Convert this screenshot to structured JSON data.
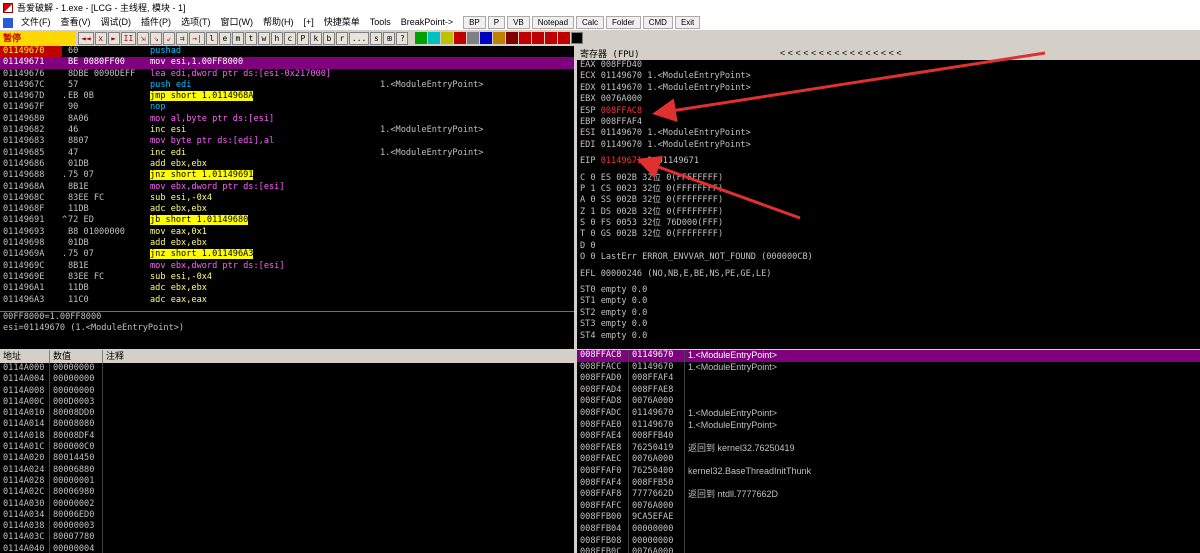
{
  "window": {
    "title": "吾爱破解 - 1.exe - [LCG - 主线程, 模块 - 1]"
  },
  "menu": {
    "items": [
      "文件(F)",
      "查看(V)",
      "调试(D)",
      "插件(P)",
      "选项(T)",
      "窗口(W)",
      "帮助(H)",
      "[+]",
      "快捷菜单",
      "Tools",
      "BreakPoint->"
    ],
    "buttons": [
      "BP",
      "P",
      "VB",
      "Notepad",
      "Calc",
      "Folder",
      "CMD",
      "Exit"
    ]
  },
  "toolbar": {
    "status": "暂停",
    "buttons": [
      "◄◄",
      "x",
      "►",
      "II",
      "⇲",
      "⇘",
      "⇙",
      "⇉",
      "→|",
      "l",
      "e",
      "m",
      "t",
      "w",
      "h",
      "c",
      "P",
      "k",
      "b",
      "r",
      "...",
      "s",
      "⊞",
      "?"
    ]
  },
  "disasm": {
    "rows": [
      {
        "addr": "01149670",
        "mark": "",
        "hex": "60",
        "code": "pushad",
        "note": "",
        "sel": false,
        "bp": true
      },
      {
        "addr": "01149671",
        "mark": "",
        "hex": "BE 0080FF00",
        "code": "mov esi,1.00FF8000",
        "note": "",
        "sel": true,
        "bp": false
      },
      {
        "addr": "01149676",
        "mark": "",
        "hex": "8DBE 0090DEFF",
        "code": "lea edi,dword ptr ds:[esi-0x217000]",
        "note": "",
        "sel": false,
        "bp": false
      },
      {
        "addr": "0114967C",
        "mark": "",
        "hex": "57",
        "code": "push edi",
        "note": "1.<ModuleEntryPoint>",
        "sel": false,
        "bp": false
      },
      {
        "addr": "0114967D",
        "mark": ".",
        "hex": "EB 0B",
        "code": "jmp short 1.0114968A",
        "note": "",
        "sel": false,
        "bp": false
      },
      {
        "addr": "0114967F",
        "mark": "",
        "hex": "90",
        "code": "nop",
        "note": "",
        "sel": false,
        "bp": false
      },
      {
        "addr": "01149680",
        "mark": "",
        "hex": "8A06",
        "code": "mov al,byte ptr ds:[esi]",
        "note": "",
        "sel": false,
        "bp": false
      },
      {
        "addr": "01149682",
        "mark": "",
        "hex": "46",
        "code": "inc esi",
        "note": "1.<ModuleEntryPoint>",
        "sel": false,
        "bp": false
      },
      {
        "addr": "01149683",
        "mark": "",
        "hex": "8807",
        "code": "mov byte ptr ds:[edi],al",
        "note": "",
        "sel": false,
        "bp": false
      },
      {
        "addr": "01149685",
        "mark": "",
        "hex": "47",
        "code": "inc edi",
        "note": "1.<ModuleEntryPoint>",
        "sel": false,
        "bp": false
      },
      {
        "addr": "01149686",
        "mark": "",
        "hex": "01DB",
        "code": "add ebx,ebx",
        "note": "",
        "sel": false,
        "bp": false
      },
      {
        "addr": "01149688",
        "mark": ".",
        "hex": "75 07",
        "code": "jnz short 1.01149691",
        "note": "",
        "sel": false,
        "bp": false
      },
      {
        "addr": "0114968A",
        "mark": "",
        "hex": "8B1E",
        "code": "mov ebx,dword ptr ds:[esi]",
        "note": "",
        "sel": false,
        "bp": false
      },
      {
        "addr": "0114968C",
        "mark": "",
        "hex": "83EE FC",
        "code": "sub esi,-0x4",
        "note": "",
        "sel": false,
        "bp": false
      },
      {
        "addr": "0114968F",
        "mark": "",
        "hex": "11DB",
        "code": "adc ebx,ebx",
        "note": "",
        "sel": false,
        "bp": false
      },
      {
        "addr": "01149691",
        "mark": "^",
        "hex": "72 ED",
        "code": "jb short 1.01149680",
        "note": "",
        "sel": false,
        "bp": false
      },
      {
        "addr": "01149693",
        "mark": "",
        "hex": "B8 01000000",
        "code": "mov eax,0x1",
        "note": "",
        "sel": false,
        "bp": false
      },
      {
        "addr": "01149698",
        "mark": "",
        "hex": "01DB",
        "code": "add ebx,ebx",
        "note": "",
        "sel": false,
        "bp": false
      },
      {
        "addr": "0114969A",
        "mark": ".",
        "hex": "75 07",
        "code": "jnz short 1.011496A3",
        "note": "",
        "sel": false,
        "bp": false
      },
      {
        "addr": "0114969C",
        "mark": "",
        "hex": "8B1E",
        "code": "mov ebx,dword ptr ds:[esi]",
        "note": "",
        "sel": false,
        "bp": false
      },
      {
        "addr": "0114969E",
        "mark": "",
        "hex": "83EE FC",
        "code": "sub esi,-0x4",
        "note": "",
        "sel": false,
        "bp": false
      },
      {
        "addr": "011496A1",
        "mark": "",
        "hex": "11DB",
        "code": "adc ebx,ebx",
        "note": "",
        "sel": false,
        "bp": false
      },
      {
        "addr": "011496A3",
        "mark": "",
        "hex": "11C0",
        "code": "adc eax,eax",
        "note": "",
        "sel": false,
        "bp": false
      }
    ]
  },
  "info": {
    "line1": "00FF8000=1.00FF8000",
    "line2": "esi=01149670 (1.<ModuleEntryPoint>)"
  },
  "registers": {
    "title": "寄存器 (FPU)",
    "arrows": "< < < < < < < < < < < < < < < <",
    "gpr": [
      {
        "text": "EAX 008FFD40",
        "red": ""
      },
      {
        "text": "ECX 01149670 1.<ModuleEntryPoint>",
        "red": ""
      },
      {
        "text": "EDX 01149670 1.<ModuleEntryPoint>",
        "red": ""
      },
      {
        "text": "EBX 0076A000",
        "red": ""
      },
      {
        "text": "ESP ",
        "red": "008FFAC8"
      },
      {
        "text": "EBP 008FFAF4",
        "red": ""
      },
      {
        "text": "ESI 01149670 1.<ModuleEntryPoint>",
        "red": ""
      },
      {
        "text": "EDI 01149670 1.<ModuleEntryPoint>",
        "red": ""
      }
    ],
    "eip": {
      "label": "EIP ",
      "value": "01149671",
      "rest": " 1.01149671"
    },
    "flags": [
      "C 0  ES 002B 32位 0(FFFFFFFF)",
      "P 1  CS 0023 32位 0(FFFFFFFF)",
      "A 0  SS 002B 32位 0(FFFFFFFF)",
      "Z 1  DS 002B 32位 0(FFFFFFFF)",
      "S 0  FS 0053 32位 76D000(FFF)",
      "T 0  GS 002B 32位 0(FFFFFFFF)",
      "D 0",
      "O 0  LastErr ERROR_ENVVAR_NOT_FOUND (000000CB)"
    ],
    "efl": "EFL 00000246 (NO,NB,E,BE,NS,PE,GE,LE)",
    "fpu": [
      "ST0 empty 0.0",
      "ST1 empty 0.0",
      "ST2 empty 0.0",
      "ST3 empty 0.0",
      "ST4 empty 0.0"
    ]
  },
  "dump": {
    "headers": [
      "地址",
      "数值",
      "注释"
    ],
    "rows": [
      [
        "0114A000",
        "00000000"
      ],
      [
        "0114A004",
        "00000000"
      ],
      [
        "0114A008",
        "00000000"
      ],
      [
        "0114A00C",
        "000D0003"
      ],
      [
        "0114A010",
        "80008DD0"
      ],
      [
        "0114A014",
        "80008080"
      ],
      [
        "0114A018",
        "80008DF4"
      ],
      [
        "0114A01C",
        "800000C0"
      ],
      [
        "0114A020",
        "80014450"
      ],
      [
        "0114A024",
        "80006880"
      ],
      [
        "0114A028",
        "00000001"
      ],
      [
        "0114A02C",
        "80006980"
      ],
      [
        "0114A030",
        "00000002"
      ],
      [
        "0114A034",
        "80006ED0"
      ],
      [
        "0114A038",
        "00000003"
      ],
      [
        "0114A03C",
        "80007780"
      ],
      [
        "0114A040",
        "00000004"
      ]
    ]
  },
  "stack": {
    "rows": [
      {
        "addr": "008FFAC8",
        "val": "01149670",
        "comment": "1.<ModuleEntryPoint>",
        "sel": true
      },
      {
        "addr": "008FFACC",
        "val": "01149670",
        "comment": "1.<ModuleEntryPoint>",
        "sel": false
      },
      {
        "addr": "008FFAD0",
        "val": "008FFAF4",
        "comment": "",
        "sel": false
      },
      {
        "addr": "008FFAD4",
        "val": "008FFAE8",
        "comment": "",
        "sel": false
      },
      {
        "addr": "008FFAD8",
        "val": "0076A000",
        "comment": "",
        "sel": false
      },
      {
        "addr": "008FFADC",
        "val": "01149670",
        "comment": "1.<ModuleEntryPoint>",
        "sel": false
      },
      {
        "addr": "008FFAE0",
        "val": "01149670",
        "comment": "1.<ModuleEntryPoint>",
        "sel": false
      },
      {
        "addr": "008FFAE4",
        "val": "008FFB40",
        "comment": "",
        "sel": false
      },
      {
        "addr": "008FFAE8",
        "val": "76250419",
        "comment": "返回到 kernel32.76250419",
        "sel": false
      },
      {
        "addr": "008FFAEC",
        "val": "0076A000",
        "comment": "",
        "sel": false
      },
      {
        "addr": "008FFAF0",
        "val": "76250400",
        "comment": "kernel32.BaseThreadInitThunk",
        "sel": false
      },
      {
        "addr": "008FFAF4",
        "val": "008FFB50",
        "comment": "",
        "sel": false
      },
      {
        "addr": "008FFAF8",
        "val": "7777662D",
        "comment": "返回到 ntdll.7777662D",
        "sel": false
      },
      {
        "addr": "008FFAFC",
        "val": "0076A000",
        "comment": "",
        "sel": false
      },
      {
        "addr": "008FFB00",
        "val": "9CA5EFAE",
        "comment": "",
        "sel": false
      },
      {
        "addr": "008FFB04",
        "val": "00000000",
        "comment": "",
        "sel": false
      },
      {
        "addr": "008FFB08",
        "val": "00000000",
        "comment": "",
        "sel": false
      },
      {
        "addr": "008FFB0C",
        "val": "0076A000",
        "comment": "",
        "sel": false
      }
    ]
  },
  "colors": {
    "selection": "#800080",
    "breakpoint": "#c00000",
    "jump": "#ffff00",
    "status": "#ffd800",
    "annotation": "#e03030"
  }
}
